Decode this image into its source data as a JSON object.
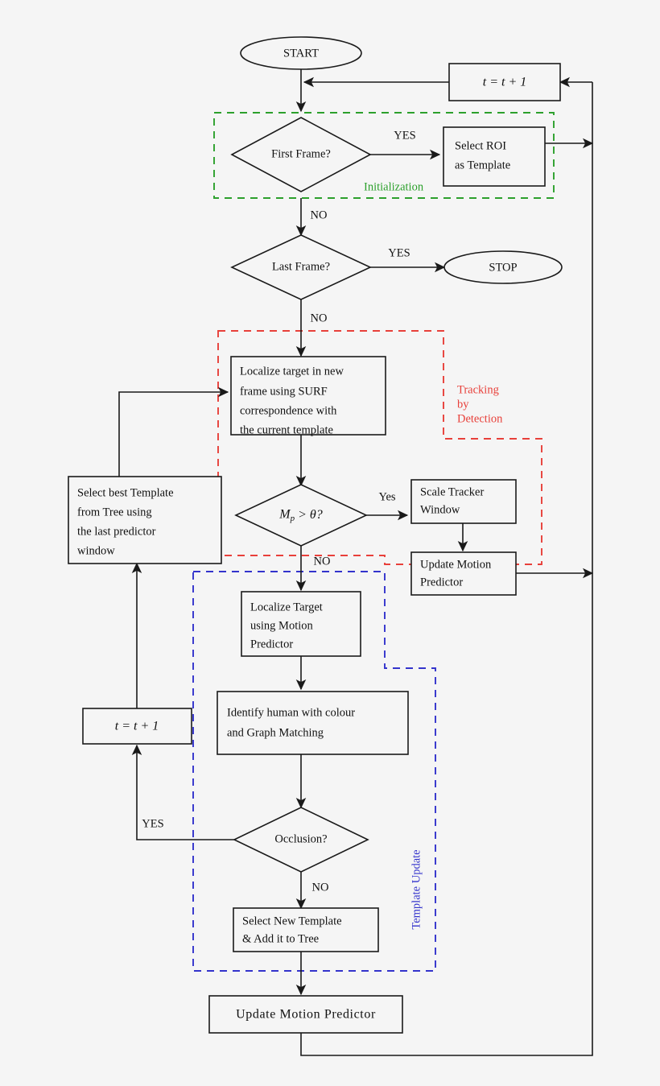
{
  "diagram": {
    "title": "Human tracking flowchart",
    "background_color": "#f5f5f5",
    "line_color": "#1a1a1a"
  },
  "nodes": {
    "start": {
      "label": "START",
      "shape": "ellipse"
    },
    "t_increment_top": {
      "label": "t = t + 1",
      "shape": "rect"
    },
    "first_frame": {
      "label": "First Frame?",
      "shape": "diamond"
    },
    "select_roi": {
      "line1": "Select ROI",
      "line2": "as Template",
      "shape": "rect"
    },
    "last_frame": {
      "label": "Last Frame?",
      "shape": "diamond"
    },
    "stop": {
      "label": "STOP",
      "shape": "ellipse"
    },
    "localize_surf": {
      "line1": "Localize target in new",
      "line2": "frame using SURF",
      "line3": "correspondence with",
      "line4": "the current template",
      "shape": "rect"
    },
    "select_best_template": {
      "line1": "Select best Template",
      "line2": "from Tree using",
      "line3": "the last predictor",
      "line4": "window",
      "shape": "rect"
    },
    "mp_threshold": {
      "label": "Mp > θ?",
      "shape": "diamond"
    },
    "scale_tracker": {
      "line1": "Scale Tracker",
      "line2": "Window",
      "shape": "rect"
    },
    "update_motion_predictor_right": {
      "line1": "Update Motion",
      "line2": "Predictor",
      "shape": "rect"
    },
    "localize_motion": {
      "line1": "Localize Target",
      "line2": "using Motion",
      "line3": "Predictor",
      "shape": "rect"
    },
    "t_increment_bottom": {
      "label": "t = t + 1",
      "shape": "rect"
    },
    "identify_human": {
      "line1": "Identify human with colour",
      "line2": "and Graph Matching",
      "shape": "rect"
    },
    "occlusion": {
      "label": "Occlusion?",
      "shape": "diamond"
    },
    "select_new_template": {
      "line1": "Select New Template",
      "line2": "& Add it to Tree",
      "shape": "rect"
    },
    "update_motion_predictor_bottom": {
      "label": "Update Motion Predictor",
      "shape": "rect"
    }
  },
  "edge_labels": {
    "first_frame_yes": "YES",
    "first_frame_no": "NO",
    "last_frame_yes": "YES",
    "last_frame_no": "NO",
    "mp_yes": "Yes",
    "mp_no": "NO",
    "occlusion_yes": "YES",
    "occlusion_no": "NO"
  },
  "groups": {
    "initialization": {
      "label": "Initialization",
      "color": "#2ca02c"
    },
    "tracking_by_detection": {
      "label_line1": "Tracking",
      "label_line2": "by",
      "label_line3": "Detection",
      "color": "#e8403a"
    },
    "template_update": {
      "label": "Template Update",
      "color": "#3333cc"
    }
  }
}
